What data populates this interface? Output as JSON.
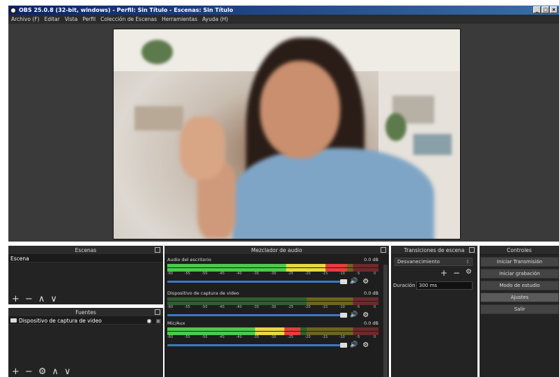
{
  "window": {
    "title": "OBS 25.0.8 (32-bit, windows) - Perfil: Sin Título - Escenas: Sin Título",
    "min_glyph": "_",
    "max_glyph": "□",
    "close_glyph": "×"
  },
  "menu": [
    "Archivo (F)",
    "Editar",
    "Vista",
    "Perfil",
    "Colección de Escenas",
    "Herramientas",
    "Ayuda (H)"
  ],
  "scenes": {
    "header": "Escenas",
    "items": [
      "Escena"
    ]
  },
  "sources": {
    "header": "Fuentes",
    "items": [
      {
        "icon": "camera-icon",
        "label": "Dispositivo de captura de video"
      }
    ]
  },
  "mixer": {
    "header": "Mezclador de audio",
    "scale": [
      "-60",
      "-55",
      "-50",
      "-45",
      "-40",
      "-35",
      "-30",
      "-25",
      "-20",
      "-15",
      "-10",
      "-5",
      "0"
    ],
    "tracks": [
      {
        "name": "Audio del escritorio",
        "db": "0.0 dB",
        "level": 0.85
      },
      {
        "name": "Dispositivo de captura de video",
        "db": "0.0 dB",
        "level": 0
      },
      {
        "name": "Mic/Aux",
        "db": "0.0 dB",
        "level": 0.63
      }
    ]
  },
  "transitions": {
    "header": "Transiciones de escena",
    "selected": "Desvanecimiento",
    "duration_label": "Duración",
    "duration_value": "300 ms"
  },
  "controls": {
    "header": "Controles",
    "buttons": [
      "Iniciar Transmisión",
      "Iniciar grabación",
      "Modo de estudio",
      "Ajustes",
      "Salir"
    ],
    "active": "Ajustes"
  },
  "colors": {
    "background": "#3a3a3a",
    "panel": "#232323",
    "meter_green": "#4ec84e",
    "meter_yellow": "#e8d840",
    "meter_red": "#e04040",
    "volume_slider": "#3a78c6"
  }
}
